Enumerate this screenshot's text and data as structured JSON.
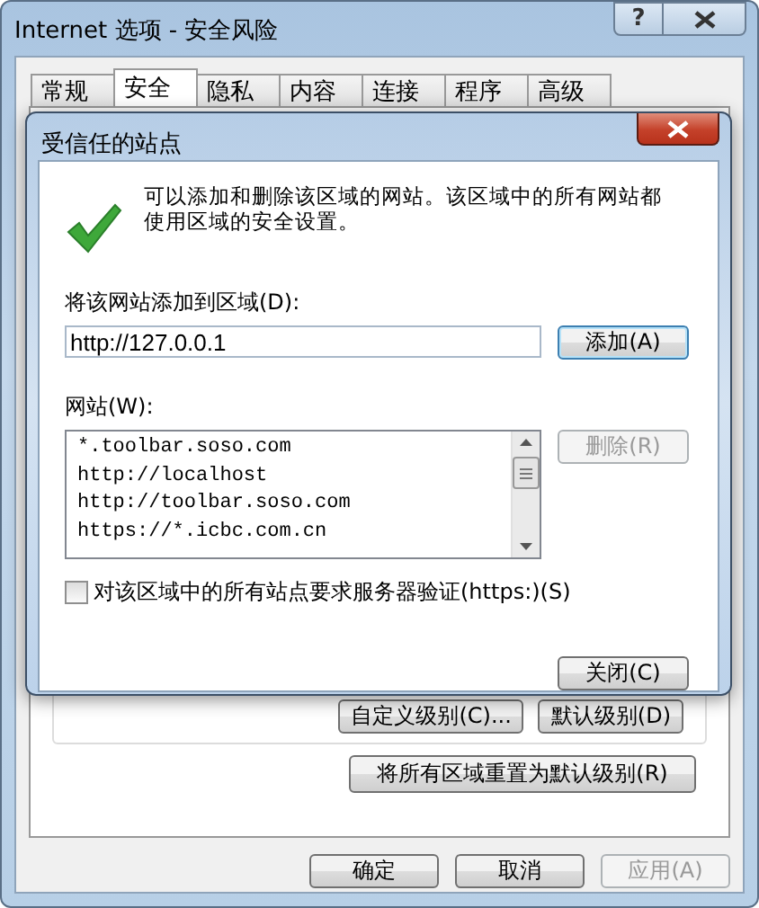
{
  "window": {
    "title": "Internet 选项 - 安全风险",
    "help_button": "?"
  },
  "tabs": [
    {
      "label": "常规",
      "selected": false
    },
    {
      "label": "安全",
      "selected": true
    },
    {
      "label": "隐私",
      "selected": false
    },
    {
      "label": "内容",
      "selected": false
    },
    {
      "label": "连接",
      "selected": false
    },
    {
      "label": "程序",
      "selected": false
    },
    {
      "label": "高级",
      "selected": false
    }
  ],
  "level_buttons": [
    {
      "label": "自定义级别(C)...",
      "disabled": false
    },
    {
      "label": "默认级别(D)",
      "disabled": false
    }
  ],
  "reset_button": "将所有区域重置为默认级别(R)",
  "footer_buttons": [
    {
      "label": "确定",
      "disabled": false
    },
    {
      "label": "取消",
      "disabled": false
    },
    {
      "label": "应用(A)",
      "disabled": true
    }
  ],
  "dialog": {
    "title": "受信任的站点",
    "message": "可以添加和删除该区域的网站。该区域中的所有网站都使用区域的安全设置。",
    "add_label": "将该网站添加到区域(D):",
    "site_input": {
      "value": "http://127.0.0.1"
    },
    "add_button": {
      "label": "添加(A)",
      "disabled": false
    },
    "sites_label": "网站(W):",
    "sites": [
      {
        "label": "*.toolbar.soso.com",
        "selected": false
      },
      {
        "label": "http://localhost",
        "selected": false
      },
      {
        "label": "http://toolbar.soso.com",
        "selected": false
      },
      {
        "label": "https://*.icbc.com.cn",
        "selected": false
      }
    ],
    "remove_button": {
      "label": "删除(R)",
      "disabled": true
    },
    "require_https": {
      "label": "对该区域中的所有站点要求服务器验证(https:)(S)",
      "checked": false
    },
    "close_button": {
      "label": "关闭(C)",
      "disabled": false
    }
  }
}
